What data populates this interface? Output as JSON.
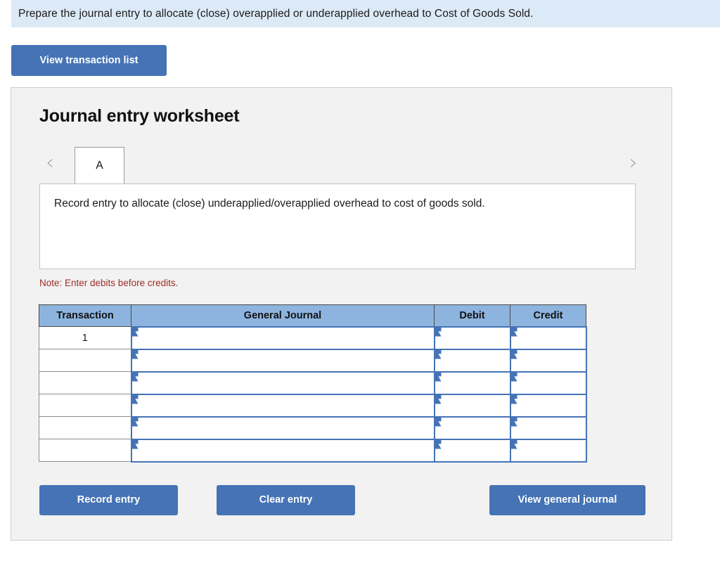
{
  "prompt": {
    "text": "Prepare the journal entry to allocate (close) overapplied or underapplied overhead to Cost of Goods Sold."
  },
  "toolbar": {
    "view_transaction_list_label": "View transaction list"
  },
  "worksheet": {
    "title": "Journal entry worksheet",
    "nav": {
      "prev_icon": "‹",
      "next_icon": "›"
    },
    "tabs": [
      {
        "label": "A",
        "active": true
      }
    ],
    "description": "Record entry to allocate (close) underapplied/overapplied overhead to cost of goods sold.",
    "note": "Note: Enter debits before credits.",
    "table": {
      "columns": [
        "Transaction",
        "General Journal",
        "Debit",
        "Credit"
      ],
      "rows": [
        {
          "transaction": "1",
          "general_journal": "",
          "debit": "",
          "credit": ""
        },
        {
          "transaction": "",
          "general_journal": "",
          "debit": "",
          "credit": ""
        },
        {
          "transaction": "",
          "general_journal": "",
          "debit": "",
          "credit": ""
        },
        {
          "transaction": "",
          "general_journal": "",
          "debit": "",
          "credit": ""
        },
        {
          "transaction": "",
          "general_journal": "",
          "debit": "",
          "credit": ""
        },
        {
          "transaction": "",
          "general_journal": "",
          "debit": "",
          "credit": ""
        }
      ]
    },
    "actions": {
      "record_entry_label": "Record entry",
      "clear_entry_label": "Clear entry",
      "view_general_journal_label": "View general journal"
    }
  },
  "colors": {
    "banner_bg": "#dce9f7",
    "button_blue": "#4573b5",
    "table_header_blue": "#8db4de",
    "note_red": "#9e2b25",
    "panel_bg": "#f2f2f2"
  }
}
